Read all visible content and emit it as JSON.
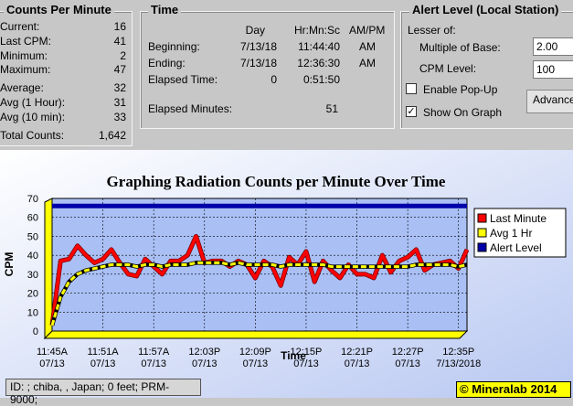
{
  "counts": {
    "title": "Counts Per Minute",
    "rows": [
      {
        "label": "Current:",
        "value": "16"
      },
      {
        "label": "Last CPM:",
        "value": "41"
      },
      {
        "label": "Minimum:",
        "value": "2"
      },
      {
        "label": "Maximum:",
        "value": "47"
      },
      {
        "label": "Average:",
        "value": "32"
      },
      {
        "label": "Avg (1 Hour):",
        "value": "31"
      },
      {
        "label": "Avg (10 min):",
        "value": "33"
      },
      {
        "label": "Total Counts:",
        "value": "1,642"
      }
    ]
  },
  "time": {
    "title": "Time",
    "headers": {
      "day": "Day",
      "hms": "Hr:Mn:Sc",
      "ampm": "AM/PM"
    },
    "beginning": {
      "label": "Beginning:",
      "day": "7/13/18",
      "hms": "11:44:40",
      "ampm": "AM"
    },
    "ending": {
      "label": "Ending:",
      "day": "7/13/18",
      "hms": "12:36:30",
      "ampm": "AM"
    },
    "elapsed": {
      "label": "Elapsed Time:",
      "day": "0",
      "hms": "0:51:50"
    },
    "elapsed_minutes": {
      "label": "Elapsed Minutes:",
      "value": "51"
    }
  },
  "alert": {
    "title": "Alert Level (Local Station)",
    "lesser": "Lesser of:",
    "multiple_label": "Multiple of Base:",
    "multiple_value": "2.00",
    "cpm_label": "CPM Level:",
    "cpm_value": "100",
    "popup_label": "Enable Pop-Up",
    "popup_checked": false,
    "graph_label": "Show On Graph",
    "graph_checked": true,
    "check_mark": "✓",
    "advanced_label": "Advanced"
  },
  "status_text": "ID: ; chiba, , Japan; 0 feet; PRM-9000;",
  "brand": "© Mineralab 2014",
  "chart_data": {
    "type": "line",
    "title": "Graphing Radiation Counts per Minute Over Time",
    "xlabel": "Time",
    "ylabel": "CPM",
    "ylim": [
      0,
      70
    ],
    "yticks": [
      0,
      10,
      20,
      30,
      40,
      50,
      60,
      70
    ],
    "grid": true,
    "legend": "right",
    "x_ticks": [
      {
        "t": 0,
        "l1": "11:45A",
        "l2": "07/13"
      },
      {
        "t": 6,
        "l1": "11:51A",
        "l2": "07/13"
      },
      {
        "t": 12,
        "l1": "11:57A",
        "l2": "07/13"
      },
      {
        "t": 18,
        "l1": "12:03P",
        "l2": "07/13"
      },
      {
        "t": 24,
        "l1": "12:09P",
        "l2": "07/13"
      },
      {
        "t": 30,
        "l1": "12:15P",
        "l2": "07/13"
      },
      {
        "t": 36,
        "l1": "12:21P",
        "l2": "07/13"
      },
      {
        "t": 42,
        "l1": "12:27P",
        "l2": "07/13"
      },
      {
        "t": 48,
        "l1": "12:35P",
        "l2": "7/13/2018"
      }
    ],
    "series": [
      {
        "name": "Last Minute",
        "color": "#ff0000",
        "values": [
          3,
          37,
          38,
          45,
          40,
          36,
          38,
          43,
          36,
          30,
          29,
          38,
          34,
          30,
          37,
          37,
          40,
          50,
          36,
          37,
          37,
          34,
          37,
          35,
          28,
          37,
          34,
          24,
          39,
          35,
          42,
          26,
          37,
          32,
          28,
          35,
          30,
          30,
          28,
          40,
          31,
          37,
          39,
          43,
          32,
          35,
          36,
          37,
          33,
          43
        ]
      },
      {
        "name": "Avg 1 Hr",
        "color": "#ffff00",
        "values": [
          3,
          18,
          26,
          30,
          32,
          33,
          34,
          35,
          35,
          35,
          34,
          35,
          35,
          34,
          35,
          35,
          35,
          36,
          36,
          36,
          36,
          35,
          36,
          35,
          35,
          35,
          35,
          34,
          35,
          35,
          35,
          35,
          35,
          34,
          34,
          34,
          34,
          34,
          34,
          34,
          34,
          34,
          34,
          35,
          35,
          35,
          35,
          35,
          34,
          35
        ]
      },
      {
        "name": "Alert Level",
        "color": "#0000aa",
        "values": [
          66,
          66,
          66,
          66,
          66,
          66,
          66,
          66,
          66,
          66,
          66,
          66,
          66,
          66,
          66,
          66,
          66,
          66,
          66,
          66,
          66,
          66,
          66,
          66,
          66,
          66,
          66,
          66,
          66,
          66,
          66,
          66,
          66,
          66,
          66,
          66,
          66,
          66,
          66,
          66,
          66,
          66,
          66,
          66,
          66,
          66,
          66,
          66,
          66,
          66
        ]
      }
    ]
  }
}
